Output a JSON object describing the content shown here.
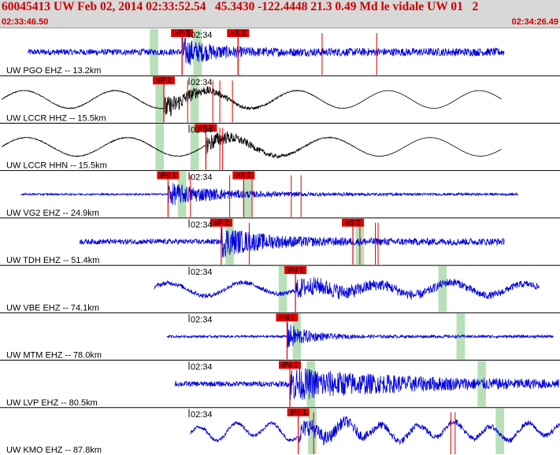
{
  "header": {
    "title": "60045413 UW Feb 02, 2014 02:33:52.54   45.3430 -122.4448 21.3 0.49 Md le vidale UW 01   2",
    "start_time": "02:33:46.50",
    "end_time": "02:34:26.49"
  },
  "colors": {
    "trace_blue": "#0000dd",
    "trace_black": "#000000",
    "pick_red": "#dd0000",
    "window_green": "#b8e0b8",
    "grid": "#888888"
  },
  "timeline": {
    "start_sec": 46.5,
    "end_sec": 86.49,
    "tick_label": "02:34",
    "tick_sec": 60
  },
  "traces": [
    {
      "label": "UW PGO EHZ -- 13.2km",
      "color": "blue",
      "style": "noise",
      "data_start": 48.5,
      "data_end": 82.5,
      "amp": 0.14,
      "event_amp": 0.55,
      "event_decay": 2.0,
      "show_tick": true,
      "picks": [
        {
          "label": "eP 2",
          "sec": 59.5
        },
        {
          "label": "eS 2",
          "sec": 63.5
        }
      ],
      "extra_lines": [
        59.5,
        63.5,
        69.5,
        73.4
      ],
      "windows": [
        {
          "start": 57.2,
          "end": 57.8
        },
        {
          "start": 60.3,
          "end": 60.9
        }
      ]
    },
    {
      "label": "UW LCCR HHZ -- 15.5km",
      "color": "black",
      "style": "wave",
      "data_start": 46.6,
      "data_end": 82.3,
      "amp": 0.4,
      "event_amp": 0.55,
      "event_decay": 3.0,
      "period": 6.5,
      "show_tick": true,
      "picks": [
        {
          "label": "eP 2",
          "sec": 58.2
        }
      ],
      "extra_lines": [
        59.9,
        61.7,
        62.2,
        63.1
      ],
      "windows": [
        {
          "start": 57.6,
          "end": 58.2
        },
        {
          "start": 60.1,
          "end": 60.7
        }
      ]
    },
    {
      "label": "UW LCCR HHN -- 15.5km",
      "color": "black",
      "style": "wave",
      "data_start": 46.6,
      "data_end": 82.3,
      "amp": 0.42,
      "event_amp": 0.45,
      "event_decay": 3.0,
      "period": 7.2,
      "show_tick": true,
      "picks": [
        {
          "label": "eS 2",
          "sec": 61.2
        }
      ],
      "extra_lines": [
        62.2,
        62.4
      ],
      "windows": [
        {
          "start": 57.6,
          "end": 58.2
        },
        {
          "start": 60.1,
          "end": 60.7
        }
      ]
    },
    {
      "label": "UW VG2 EHZ -- 24.9km",
      "color": "blue",
      "style": "noise",
      "data_start": 48.0,
      "data_end": 83.5,
      "amp": 0.04,
      "event_amp": 0.5,
      "event_decay": 4.0,
      "show_tick": true,
      "picks": [
        {
          "label": "iPd 1",
          "sec": 58.5
        },
        {
          "label": "eS 2",
          "sec": 63.9
        }
      ],
      "extra_lines": [
        60.1,
        62.9,
        64.5,
        67.3,
        68.0
      ],
      "windows": [
        {
          "start": 59.2,
          "end": 59.8
        },
        {
          "start": 63.9,
          "end": 64.5
        }
      ]
    },
    {
      "label": "UW TDH EHZ -- 51.4km",
      "color": "blue",
      "style": "noise",
      "data_start": 52.2,
      "data_end": 82.5,
      "amp": 0.12,
      "event_amp": 0.6,
      "event_decay": 3.0,
      "show_tick": true,
      "picks": [
        {
          "label": "eP 2",
          "sec": 62.3
        },
        {
          "label": "eS 2",
          "sec": 71.7
        }
      ],
      "extra_lines": [
        64.3,
        72.2,
        73.3,
        73.5
      ],
      "windows": [
        {
          "start": 62.6,
          "end": 63.2
        },
        {
          "start": 71.9,
          "end": 72.5
        }
      ]
    },
    {
      "label": "UW VBE EHZ -- 74.1km",
      "color": "blue",
      "style": "lumpy",
      "data_start": 57.5,
      "data_end": 85.0,
      "amp": 0.1,
      "event_amp": 0.35,
      "event_decay": 6.0,
      "period": 5.0,
      "wave_amp": 0.22,
      "show_tick": true,
      "picks": [
        {
          "label": "iPd 1",
          "sec": 67.6
        }
      ],
      "extra_lines": [],
      "windows": [
        {
          "start": 66.4,
          "end": 67.0
        },
        {
          "start": 77.8,
          "end": 78.4
        }
      ]
    },
    {
      "label": "UW MTM EHZ -- 78.0km",
      "color": "blue",
      "style": "noise",
      "data_start": 58.4,
      "data_end": 86.0,
      "amp": 0.05,
      "event_amp": 0.6,
      "event_decay": 1.5,
      "show_tick": true,
      "picks": [
        {
          "label": "iPd 1",
          "sec": 67.0
        }
      ],
      "extra_lines": [],
      "windows": [
        {
          "start": 67.4,
          "end": 68.0
        },
        {
          "start": 79.1,
          "end": 79.7
        }
      ]
    },
    {
      "label": "UW LVP EHZ -- 80.5km",
      "color": "blue",
      "style": "noise",
      "data_start": 59.0,
      "data_end": 86.4,
      "amp": 0.12,
      "event_amp": 0.65,
      "event_decay": 8.0,
      "show_tick": true,
      "picks": [
        {
          "label": "iPd 1",
          "sec": 67.2
        }
      ],
      "extra_lines": [],
      "windows": [
        {
          "start": 68.4,
          "end": 69.0
        },
        {
          "start": 80.6,
          "end": 81.2
        }
      ]
    },
    {
      "label": "UW KMO EHZ -- 87.8km",
      "color": "blue",
      "style": "lumpy",
      "data_start": 60.1,
      "data_end": 86.5,
      "amp": 0.08,
      "event_amp": 0.35,
      "event_decay": 4.0,
      "period": 2.6,
      "wave_amp": 0.32,
      "show_tick": true,
      "picks": [
        {
          "label": "iPd 1",
          "sec": 67.8
        }
      ],
      "extra_lines": [
        68.9,
        78.7,
        79.0
      ],
      "windows": [
        {
          "start": 68.5,
          "end": 69.1
        },
        {
          "start": 81.9,
          "end": 82.5
        }
      ]
    }
  ]
}
